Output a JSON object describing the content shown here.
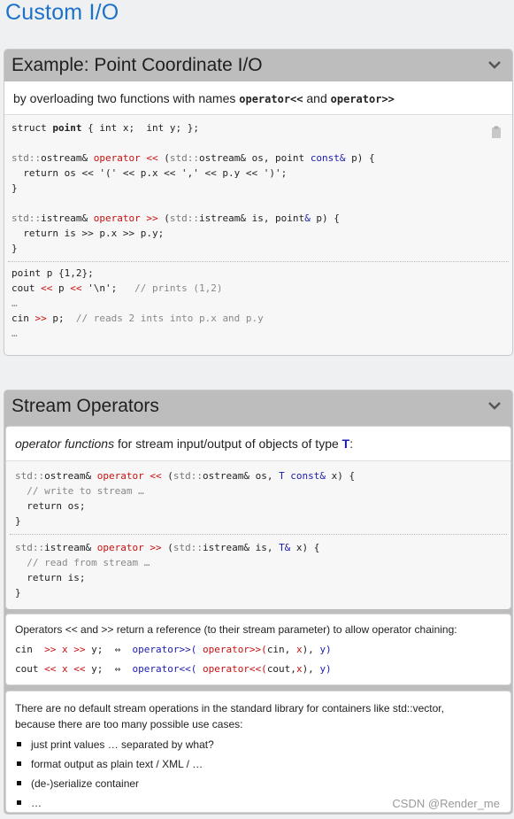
{
  "page_title": "Custom I/O",
  "panel1": {
    "title": "Example: Point Coordinate I/O",
    "desc_prefix": "by overloading two functions with names ",
    "desc_op1": "operator<<",
    "desc_mid": " and ",
    "desc_op2": "operator>>"
  },
  "panel2": {
    "title": "Stream Operators",
    "desc_italic": "operator functions",
    "desc_rest": " for stream input/output of objects of type ",
    "desc_type": "T",
    "desc_colon": ":",
    "chaining_text": "Operators << and >> return a reference (to their stream parameter) to allow operator chaining:",
    "no_default_text_1": "There are no default stream operations in the standard library for containers like std::vector,",
    "no_default_text_2": "because there are too many possible use cases:",
    "bullets": [
      "just print values … separated by what?",
      "format output as plain text / XML / …",
      "(de-)serialize container",
      "…"
    ]
  },
  "watermark": "CSDN @Render_me"
}
